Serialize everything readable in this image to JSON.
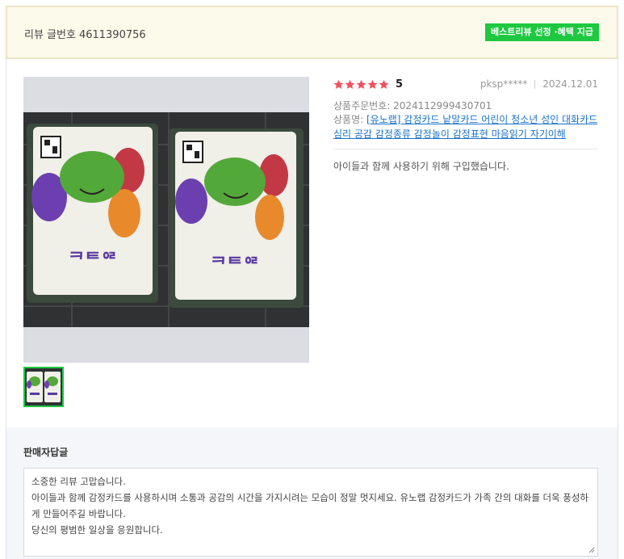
{
  "header": {
    "review_no_label": "리뷰 글번호",
    "review_no": "4611390756",
    "badge": "베스트리뷰 선정 ·혜택 지급"
  },
  "review": {
    "rating": 5,
    "score_text": "5",
    "author": "pksp*****",
    "date": "2024.12.01",
    "order_no_label": "상품주문번호: ",
    "order_no": "2024112999430701",
    "product_label": "상품명: ",
    "product_name": "[유노랩] 감정카드 낱말카드 어린이 청소년 성인 대화카드 심리 공감 감정종류 감정놀이 감정표현 마음읽기 자기이해",
    "content": "아이들과 함께 사용하기 위해 구입했습니다."
  },
  "seller_reply": {
    "title": "판매자답글",
    "lines": [
      "소중한 리뷰 고맙습니다.",
      "아이들과 함께 감정카드를 사용하시며 소통과 공감의 시간을 가지시려는 모습이 정말 멋지세요. 유노랩 감정카드가 가족 간의 대화를 더욱 풍성하게 만들어주길 바랍니다.",
      "당신의 평범한 일상을 응원합니다."
    ]
  },
  "colors": {
    "badge": "#1ec840",
    "star": "#f0525f",
    "link": "#1b72c9",
    "header_bg": "#fcfaea"
  }
}
